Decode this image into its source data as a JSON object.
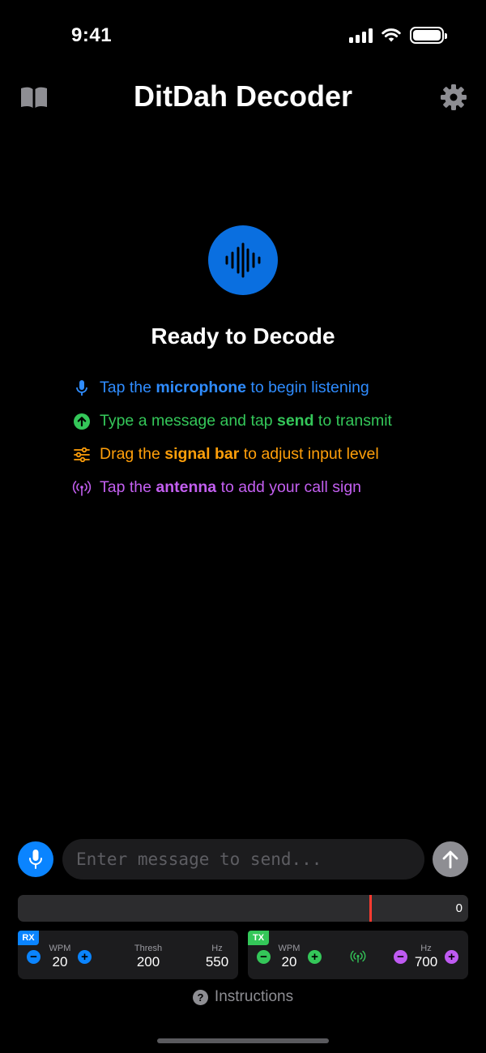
{
  "status_bar": {
    "time": "9:41"
  },
  "header": {
    "title": "DitDah Decoder",
    "left_icon": "book-icon",
    "right_icon": "gear-icon"
  },
  "empty_state": {
    "icon": "waveform-icon",
    "title": "Ready to Decode",
    "tips": [
      {
        "icon": "mic-icon",
        "color": "#2f8cff",
        "pre": "Tap the ",
        "bold": "microphone",
        "post": " to begin listening"
      },
      {
        "icon": "arrow-up-circle-icon",
        "color": "#34c759",
        "pre": "Type a message and tap ",
        "bold": "send",
        "post": " to transmit"
      },
      {
        "icon": "sliders-icon",
        "color": "#ff9f0a",
        "pre": "Drag the ",
        "bold": "signal bar",
        "post": " to adjust input level"
      },
      {
        "icon": "antenna-icon",
        "color": "#c35ff0",
        "pre": "Tap the ",
        "bold": "antenna",
        "post": " to add your call sign"
      }
    ]
  },
  "composer": {
    "placeholder": "Enter message to send...",
    "mic_icon": "mic-icon",
    "send_icon": "arrow-up-icon"
  },
  "signal_bar": {
    "value": "0",
    "threshold_marker_fraction": 0.78,
    "marker_color": "#ff3b30"
  },
  "rx": {
    "tag": "RX",
    "wpm_label": "WPM",
    "wpm": "20",
    "thresh_label": "Thresh",
    "thresh": "200",
    "hz_label": "Hz",
    "hz": "550"
  },
  "tx": {
    "tag": "TX",
    "wpm_label": "WPM",
    "wpm": "20",
    "hz_label": "Hz",
    "hz": "700"
  },
  "footer": {
    "instructions": "Instructions"
  },
  "colors": {
    "blue": "#0a84ff",
    "green": "#34c759",
    "orange": "#ff9f0a",
    "purple": "#bf5af2",
    "background": "#000000"
  }
}
